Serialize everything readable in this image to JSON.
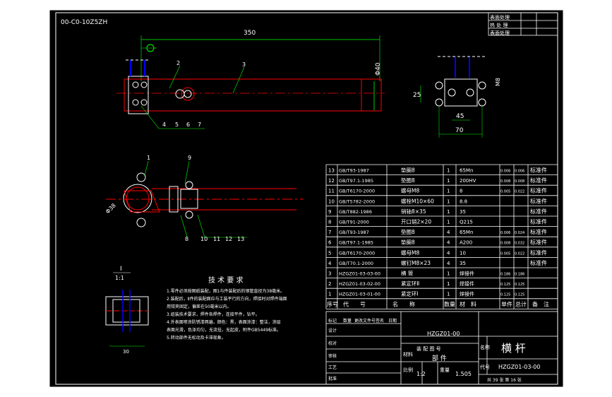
{
  "drawing_number": "00-C0-10Z5ZH",
  "title_box_labels": [
    "表面处理",
    "热 处 理",
    "表面处理"
  ],
  "dims": {
    "overall_length": "350",
    "diameter": "Φ40",
    "d25": "25",
    "d45": "45",
    "d70": "70",
    "m8": "M8",
    "phi38": "Φ38",
    "d30": "30"
  },
  "balloons_top": [
    "2",
    "3",
    "4",
    "5",
    "6",
    "7"
  ],
  "balloons_section": [
    "1",
    "9",
    "8",
    "10",
    "11",
    "12",
    "13"
  ],
  "section_label": {
    "letter": "I",
    "scale": "1:1"
  },
  "tech_req": {
    "title": "技 术 要 求",
    "lines": [
      "1.零件必须按图纸装配，图1与件装配后的钢管直径为38毫米。",
      "2.装配后，Ⅱ件的装配面应与工装平行的方向，焊接时对焊件端面",
      "  用钳夹固定，偏差在50毫米以内。",
      "3.组装技术要求，焊件各焊件，连接平件，钻平。",
      "4.外表面喷涂防锈漆两遍，颜色：黑，表面涂漆：整洁，涂层",
      "  表面光滑，色泽均匀，无流挂，无起皮，附件GB5449标准。",
      "5.转动部件无松动及卡滞现象。"
    ]
  },
  "bom_rows": [
    {
      "no": "13",
      "code": "GB/T93-1987",
      "name": "垫圈8",
      "qty": "1",
      "mat": "65Mn",
      "w1": "0.006",
      "w2": "0.006",
      "note": "标准件"
    },
    {
      "no": "12",
      "code": "GB/T97.1-1985",
      "name": "垫圈8",
      "qty": "1",
      "mat": "200HV",
      "w1": "0.008",
      "w2": "0.008",
      "note": "标准件"
    },
    {
      "no": "11",
      "code": "GB/T6170-2000",
      "name": "螺母M8",
      "qty": "1",
      "mat": "8",
      "w1": "0.005",
      "w2": "0.022",
      "note": "标准件"
    },
    {
      "no": "10",
      "code": "GB/T5782-2000",
      "name": "螺栓M10×60",
      "qty": "1",
      "mat": "8.8",
      "w1": "",
      "w2": "",
      "note": "标准件"
    },
    {
      "no": "9",
      "code": "GB/T882-1986",
      "name": "销轴8×35",
      "qty": "1",
      "mat": "35",
      "w1": "",
      "w2": "",
      "note": "标准件"
    },
    {
      "no": "8",
      "code": "GB/T91-2000",
      "name": "开口销2×20",
      "qty": "1",
      "mat": "Q215",
      "w1": "",
      "w2": "",
      "note": "标准件"
    },
    {
      "no": "7",
      "code": "GB/T93-1987",
      "name": "垫圈8",
      "qty": "4",
      "mat": "65Mn",
      "w1": "0.006",
      "w2": "0.024",
      "note": "标准件"
    },
    {
      "no": "6",
      "code": "GB/T97.1-1985",
      "name": "垫圈8",
      "qty": "4",
      "mat": "A200",
      "w1": "0.008",
      "w2": "0.032",
      "note": "标准件"
    },
    {
      "no": "5",
      "code": "GB/T6170-2000",
      "name": "螺母M8",
      "qty": "4",
      "mat": "10",
      "w1": "0.005",
      "w2": "0.022",
      "note": "标准件"
    },
    {
      "no": "4",
      "code": "GB/T70.1-2000",
      "name": "螺钉M8×23",
      "qty": "4",
      "mat": "35",
      "w1": "",
      "w2": "",
      "note": "标准件"
    },
    {
      "no": "3",
      "code": "HZGZ01-03-03-00",
      "name": "横 管",
      "qty": "1",
      "mat": "焊接件",
      "w1": "0.186",
      "w2": "0.186",
      "note": ""
    },
    {
      "no": "2",
      "code": "HZGZ01-03-02-00",
      "name": "紧定环Ⅱ",
      "qty": "1",
      "mat": "焊接件",
      "w1": "0.125",
      "w2": "0.125",
      "note": ""
    },
    {
      "no": "1",
      "code": "HZGZ01-03-01-00",
      "name": "紧定环Ⅰ",
      "qty": "1",
      "mat": "焊接件",
      "w1": "0.125",
      "w2": "0.125",
      "note": ""
    }
  ],
  "bom_header": [
    "序号",
    "代　　号",
    "名　　称",
    "数量",
    "材　料",
    "单件",
    "总计",
    "备　注"
  ],
  "title_block": {
    "drawing_no_small": "HZGZ01-00",
    "drawing_no": "HZGZ01-03-00",
    "part_name": "横 杆",
    "kind": "部 件",
    "scale": "1:2",
    "weight": "1.505",
    "left_labels": [
      "标记",
      "设计",
      "校对",
      "审核",
      "工艺",
      "批准"
    ],
    "mid_labels": [
      "数量",
      "更改文件号",
      "签名",
      "日期"
    ],
    "type_labels": [
      "装 配 图 号",
      "材料",
      "比例",
      "重量",
      "名称",
      "代号"
    ],
    "page": "共 39 张  第 16 张"
  }
}
